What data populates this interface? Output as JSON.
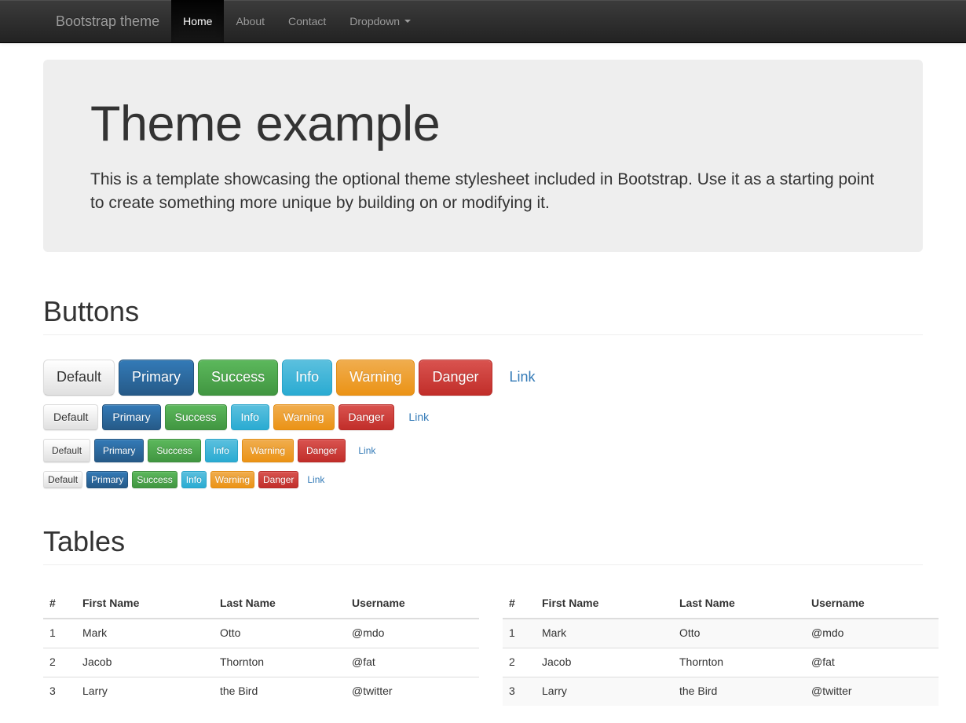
{
  "navbar": {
    "brand": "Bootstrap theme",
    "items": [
      {
        "label": "Home",
        "active": true
      },
      {
        "label": "About",
        "active": false
      },
      {
        "label": "Contact",
        "active": false
      },
      {
        "label": "Dropdown",
        "active": false,
        "caret": true
      }
    ]
  },
  "jumbotron": {
    "title": "Theme example",
    "lead": "This is a template showcasing the optional theme stylesheet included in Bootstrap. Use it as a starting point to create something more unique by building on or modifying it."
  },
  "sections": {
    "buttons_heading": "Buttons",
    "tables_heading": "Tables"
  },
  "buttons": {
    "labels": {
      "default": "Default",
      "primary": "Primary",
      "success": "Success",
      "info": "Info",
      "warning": "Warning",
      "danger": "Danger",
      "link": "Link"
    },
    "colors": {
      "default": "#e0e0e0",
      "primary": "#337ab7",
      "success": "#5cb85c",
      "info": "#5bc0de",
      "warning": "#f0ad4e",
      "danger": "#d9534f",
      "link": "#337ab7"
    }
  },
  "tables": {
    "columns": [
      "#",
      "First Name",
      "Last Name",
      "Username"
    ],
    "rows": [
      [
        "1",
        "Mark",
        "Otto",
        "@mdo"
      ],
      [
        "2",
        "Jacob",
        "Thornton",
        "@fat"
      ],
      [
        "3",
        "Larry",
        "the Bird",
        "@twitter"
      ]
    ]
  }
}
